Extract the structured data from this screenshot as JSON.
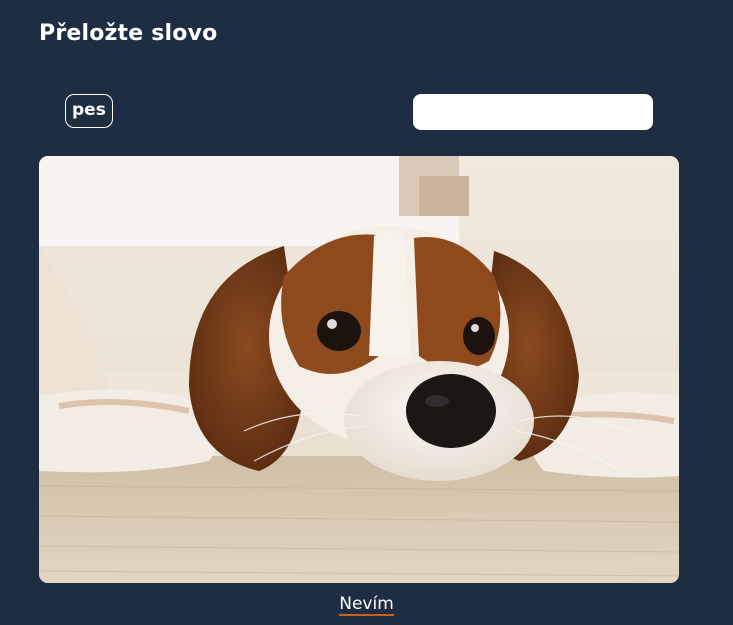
{
  "header": {
    "title": "Přeložte slovo"
  },
  "exercise": {
    "word": "pes",
    "answer_value": "",
    "answer_placeholder": ""
  },
  "image": {
    "subject": "dog"
  },
  "actions": {
    "dont_know_label": "Nevím"
  },
  "colors": {
    "background": "#1e2d41",
    "text": "#ffffff",
    "input_background": "#ffffff",
    "link_underline": "#d35d1c"
  }
}
